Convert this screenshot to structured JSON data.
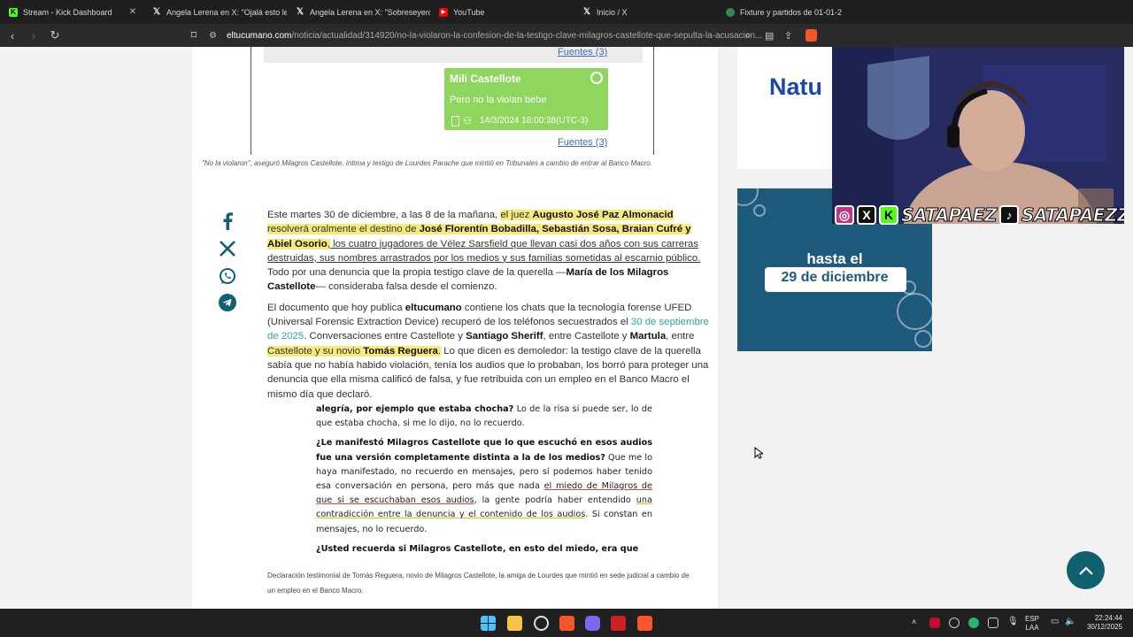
{
  "browser": {
    "tabs": [
      {
        "title": "Stream - Kick Dashboard",
        "icon": "kick-icon",
        "color": "#53fc18"
      },
      {
        "title": "Angela Lerena en X: \"Ojalá esto les c",
        "icon": "x-icon",
        "color": "#000000"
      },
      {
        "title": "Angela Lerena en X: \"Sobreseyeron a",
        "icon": "x-icon",
        "color": "#000000"
      },
      {
        "title": "YouTube",
        "icon": "youtube-icon",
        "color": "#ff0000"
      },
      {
        "title": "Inicio / X",
        "icon": "x-icon",
        "color": "#000000"
      },
      {
        "title": "Fixture y partidos de 01-01-2",
        "icon": "ball-icon",
        "color": "#2e8b57"
      }
    ],
    "url_host": "eltucumano.com",
    "url_path": "/noticia/actualidad/314920/no-la-violaron-la-confesion-de-la-testigo-clave-milagros-castellote-que-sepulta-la-acusacion..."
  },
  "chat_image": {
    "fuentes_top": "Fuentes (3)",
    "fuentes_bottom": "Fuentes (3)",
    "sender": "Mili Castellote",
    "message": "Pero no la violan bebe",
    "timestamp": "14/3/2024 18:00:38(UTC-3)"
  },
  "caption1": "\"No la violaron\", aseguró Milagros Castellote, íntima y testigo de Lourdes Parache que mintió en Tribunales a cambio de entrar al Banco Macro.",
  "share": [
    "facebook-icon",
    "x-icon",
    "whatsapp-icon",
    "telegram-icon"
  ],
  "article": {
    "p1_a": "Este martes 30 de diciembre, a las 8 de la mañana, ",
    "p1_b": "el juez ",
    "p1_c": "Augusto José Paz Almonacid",
    "p1_d": " resolverá oralmente el destino de ",
    "p1_e": "José Florentín Bobadilla, Sebastián Sosa, Braian Cufré y Abiel Osorio",
    "p1_f": ",",
    "p1_g": " los cuatro jugadores de Vélez Sarsfield que llevan casi dos años con sus carreras destruidas, sus nombres arrastrados por los medios y sus familias sometidas al escarnio público.",
    "p1_h": " Todo por una denuncia que la propia testigo clave de la querella —",
    "p1_i": "María de los Milagros Castellote",
    "p1_j": "— consideraba falsa desde el comienzo.",
    "p2_a": "El documento que hoy publica ",
    "p2_b": "eltucumano",
    "p2_c": " contiene los chats que la tecnología forense UFED (Universal Forensic Extraction Device) recuperó de los teléfonos secuestrados el ",
    "p2_d": "30 de septiembre de 2025",
    "p2_e": ". Conversaciones entre Castellote y ",
    "p2_f": "Santiago Sheriff",
    "p2_g": ", entre Castellote y ",
    "p2_h": "Martula",
    "p2_i": ", entre ",
    "p2_j": "Castellote y su novio ",
    "p2_k": "Tomás Reguera",
    "p2_l": ".",
    "p2_m": " Lo que dicen es demoledor: la testigo clave de la querella sabía que no había habido violación, tenía los audios que lo probaban, los borró para proteger una denuncia que ella misma calificó de falsa, y fue retribuida con un empleo en el Banco Macro el mismo día que declaró."
  },
  "doc_image": {
    "q0_a": "alegría, por ejemplo que estaba chocha?",
    "q0_b": " Lo de la risa si puede ser, lo de que estaba chocha, si me lo dijo, no lo recuerdo.",
    "q1": "¿Le manifestó Milagros Castellote que lo que escuchó en esos audios fue una versión completamente distinta a la de los medios?",
    "a1_a": " Que me lo haya manifestado, no recuerdo en mensajes, pero sí podemos haber tenido esa conversación en persona, pero más que nada ",
    "a1_b": "el miedo de Milagros de que si se escuchaban esos audios",
    "a1_c": ", la gente podría haber entendido ",
    "a1_d": "una contradicción entre la denuncia y el contenido de los audios",
    "a1_e": ". Si constan en mensajes, no lo recuerdo.",
    "q2": "¿Usted recuerda si Milagros Castellote, en esto del miedo, era que"
  },
  "caption2": "Declaración testimonial de Tomás Reguera, novio de Milagros Castellote, la amiga de Lourdes que mintió en sede judicial a cambio de un empleo en el Banco Macro.",
  "ads": {
    "natura_text": "Natu",
    "promo_line1": "hasta el",
    "promo_line2": "29 de diciembre"
  },
  "overlay": {
    "handle1": "SATAPAEZ",
    "handle2": "SATAPAEZZ"
  },
  "taskbar": {
    "lang1": "ESP",
    "lang2": "LAA",
    "time": "22:24:44",
    "date": "30/12/2025"
  },
  "colors": {
    "accent_teal": "#10616f",
    "highlight": "#f8ea7a",
    "chat_green": "#8fd65f"
  }
}
